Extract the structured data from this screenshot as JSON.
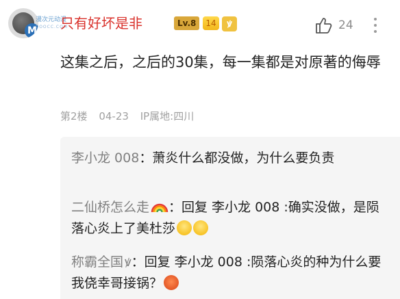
{
  "header": {
    "watermark_text": "漫次元动漫",
    "watermark_sub": "COOCC.COM",
    "username": "只有好坏是非",
    "level_badge": "Lv.8",
    "gem_badge": "14",
    "zodiac_badge": "ꝟ",
    "like_count": "24",
    "icons": [
      "avatar",
      "level-badge",
      "gem-badge",
      "zodiac-badge",
      "thumbs-up-icon",
      "more-vertical-icon"
    ]
  },
  "post": {
    "content": "这集之后，之后的30集，每一集都是对原著的侮辱",
    "floor": "第2楼",
    "date": "04-23",
    "ip_location": "IP属地:四川"
  },
  "replies": [
    {
      "author": "李小龙 008",
      "text": "：萧炎什么都没做，为什么要负责"
    },
    {
      "author": "二仙桥怎么走",
      "author_icon": "rainbow-emoji",
      "text": "：回复 李小龙 008 :确实没做，是陨落心炎上了美杜莎",
      "trailing_emoji": [
        "grimace-emoji",
        "grimace-emoji"
      ]
    },
    {
      "author": "称霸全国",
      "author_icon": "ꝟ",
      "text": "：回复 李小龙 008 :陨落心炎的种为什么要我侥幸哥接锅？",
      "trailing_emoji": [
        "angry-emoji"
      ]
    }
  ],
  "colors": {
    "username": "#d9312b",
    "meta_gray": "#a0a0a0",
    "reply_bg": "#f5f5f5",
    "level_gold": "#d9a73a"
  }
}
